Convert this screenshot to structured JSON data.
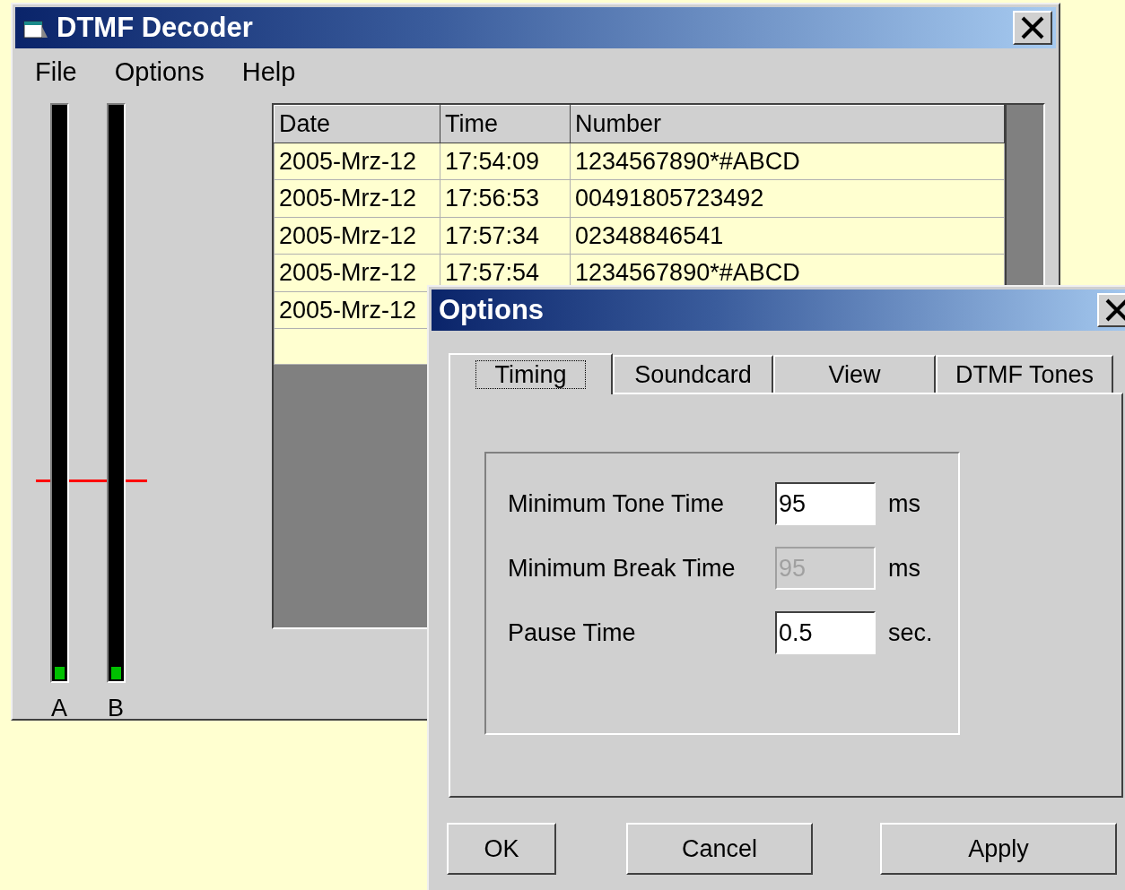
{
  "main_window": {
    "title": "DTMF Decoder",
    "menu": [
      "File",
      "Options",
      "Help"
    ],
    "meters": [
      {
        "label": "A",
        "level": 0.02
      },
      {
        "label": "B",
        "level": 0.02
      }
    ],
    "table": {
      "columns": [
        "Date",
        "Time",
        "Number"
      ],
      "rows": [
        {
          "date": "2005-Mrz-12",
          "time": "17:54:09",
          "number": "1234567890*#ABCD"
        },
        {
          "date": "2005-Mrz-12",
          "time": "17:56:53",
          "number": "00491805723492"
        },
        {
          "date": "2005-Mrz-12",
          "time": "17:57:34",
          "number": "02348846541"
        },
        {
          "date": "2005-Mrz-12",
          "time": "17:57:54",
          "number": "1234567890*#ABCD"
        },
        {
          "date": "2005-Mrz-12"
        }
      ]
    }
  },
  "dialog": {
    "title": "Options",
    "tabs": [
      {
        "label": "Timing",
        "selected": true
      },
      {
        "label": "Soundcard",
        "selected": false
      },
      {
        "label": "View",
        "selected": false
      },
      {
        "label": "DTMF Tones",
        "selected": false
      }
    ],
    "fields": [
      {
        "label": "Minimum Tone Time",
        "value": "95",
        "unit": "ms",
        "disabled": false
      },
      {
        "label": "Minimum Break Time",
        "value": "95",
        "unit": "ms",
        "disabled": true
      },
      {
        "label": "Pause Time",
        "value": "0.5",
        "unit": "sec.",
        "disabled": false
      }
    ],
    "buttons": [
      "OK",
      "Cancel",
      "Apply"
    ]
  }
}
